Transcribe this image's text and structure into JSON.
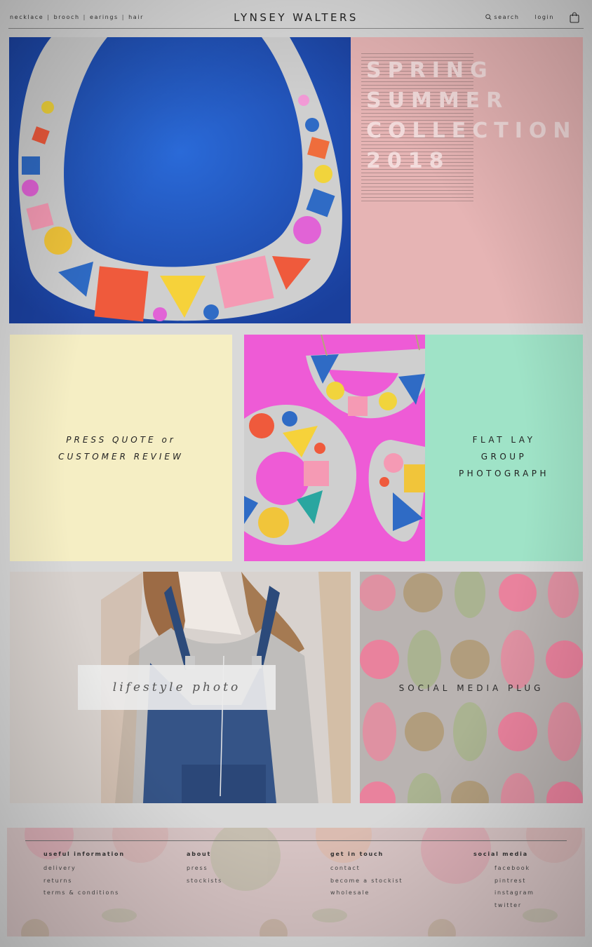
{
  "header": {
    "nav": [
      "necklace",
      "brooch",
      "earings",
      "hair"
    ],
    "separator": "|",
    "brand": "LYNSEY WALTERS",
    "search_label": "search",
    "login_label": "login"
  },
  "hero": {
    "collection_lines": [
      "SPRING",
      "SUMMER",
      "COLLECTION",
      "2018"
    ]
  },
  "tiles": {
    "quote_lines": [
      "PRESS QUOTE or",
      "CUSTOMER REVIEW"
    ],
    "flatlay_lines": [
      "FLAT LAY",
      "GROUP",
      "PHOTOGRAPH"
    ],
    "lifestyle_label": "lifestyle photo",
    "social_label": "SOCIAL MEDIA PLUG"
  },
  "footer": {
    "columns": [
      {
        "heading": "useful information",
        "items": [
          "delivery",
          "returns",
          "terms & conditions"
        ]
      },
      {
        "heading": "about",
        "items": [
          "press",
          "stockists"
        ]
      },
      {
        "heading": "get in touch",
        "items": [
          "contact",
          "become a stockist",
          "wholesale"
        ]
      },
      {
        "heading": "social media",
        "items": [
          "facebook",
          "pintrest",
          "instagram",
          "twitter"
        ]
      }
    ]
  },
  "colors": {
    "hero_blue": "#1f52b8",
    "hero_pink": "#e6b4b4",
    "quote_yellow": "#f5eec4",
    "flatlay_pink": "#ee5bd6",
    "mint": "#9fe3c7",
    "footer_pink": "#d6c3c3"
  },
  "icons": {
    "search": "search-icon",
    "cart": "shopping-bag-icon"
  }
}
